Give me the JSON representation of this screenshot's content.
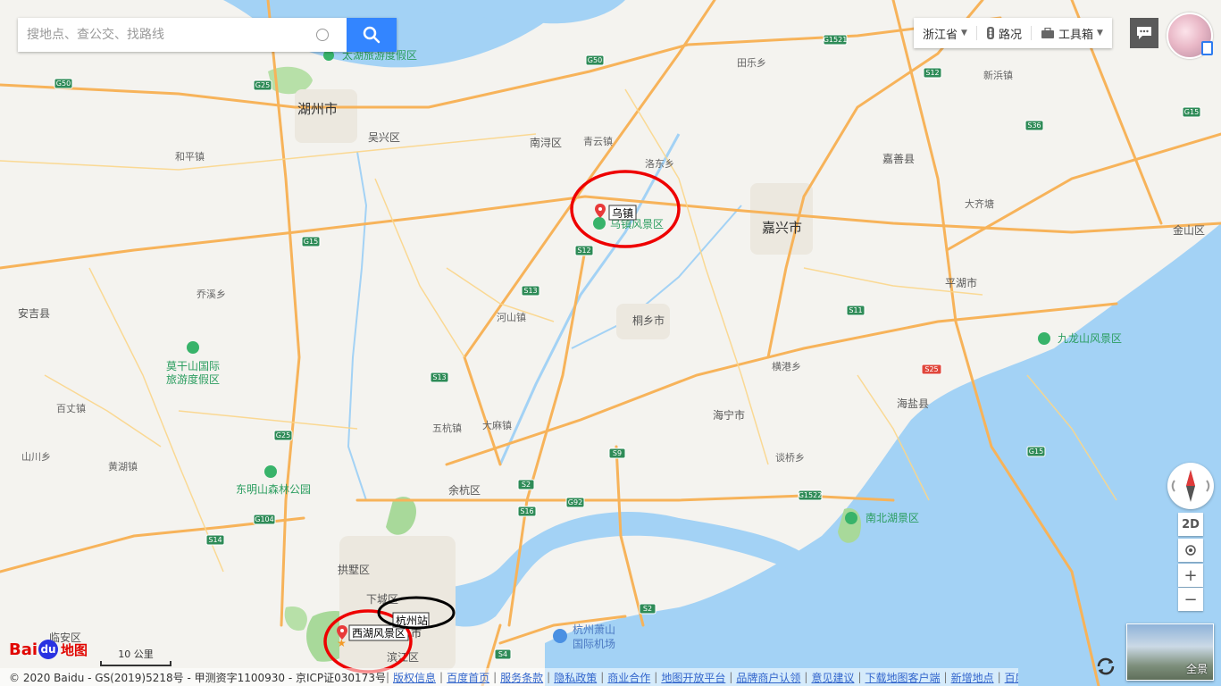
{
  "search": {
    "placeholder": "搜地点、查公交、找路线"
  },
  "toolbar": {
    "province": "浙江省",
    "traffic": "路况",
    "toolbox": "工具箱"
  },
  "map": {
    "cities": [
      "湖州市",
      "嘉兴市",
      "安吉县",
      "桐乡市",
      "海宁市",
      "平湖市",
      "嘉善县",
      "海盐县",
      "余杭区",
      "拱墅区",
      "临安区",
      "南浔区",
      "吴兴区",
      "金山区",
      "下城区",
      "滨江区"
    ],
    "towns": [
      "和平镇",
      "乔溪乡",
      "百丈镇",
      "山川乡",
      "黄湖镇",
      "五杭镇",
      "大麻镇",
      "河山镇",
      "横港乡",
      "谈桥乡",
      "青云镇",
      "洛东乡",
      "田乐乡",
      "新浜镇",
      "大齐塘"
    ],
    "pois": [
      "太湖旅游度假区",
      "莫干山国际",
      "旅游度假区",
      "东明山森林公园",
      "乌镇风景区",
      "南北湖景区",
      "九龙山风景区",
      "杭州萧山",
      "国际机场"
    ],
    "highways": [
      "G50",
      "G25",
      "G50",
      "G1521",
      "G15",
      "S12",
      "S36",
      "G15",
      "S13",
      "S12",
      "S11",
      "S13",
      "G25",
      "S9",
      "G92",
      "S2",
      "G1522",
      "G15",
      "S14",
      "G104",
      "S4",
      "S2",
      "S25",
      "S16"
    ],
    "markers": {
      "wuzhen": "乌镇",
      "xihu": "西湖风景区",
      "hangzhou_station": "杭州站",
      "city_fragment": "市"
    }
  },
  "controls": {
    "mode": "2D",
    "zoom_in": "+",
    "zoom_out": "−",
    "panorama": "全景"
  },
  "scale": {
    "label": "10 公里"
  },
  "logo": {
    "bai": "Bai",
    "du": "du",
    "ditu": "地图"
  },
  "footer": {
    "copyright": "© 2020 Baidu - GS(2019)5218号 - 甲测资字1100930 - 京ICP证030173号",
    "links": [
      "版权信息",
      "百度首页",
      "服务条款",
      "隐私政策",
      "商业合作",
      "地图开放平台",
      "品牌商户认领",
      "意见建议",
      "下载地图客户端",
      "新增地点",
      "百度营销"
    ]
  }
}
